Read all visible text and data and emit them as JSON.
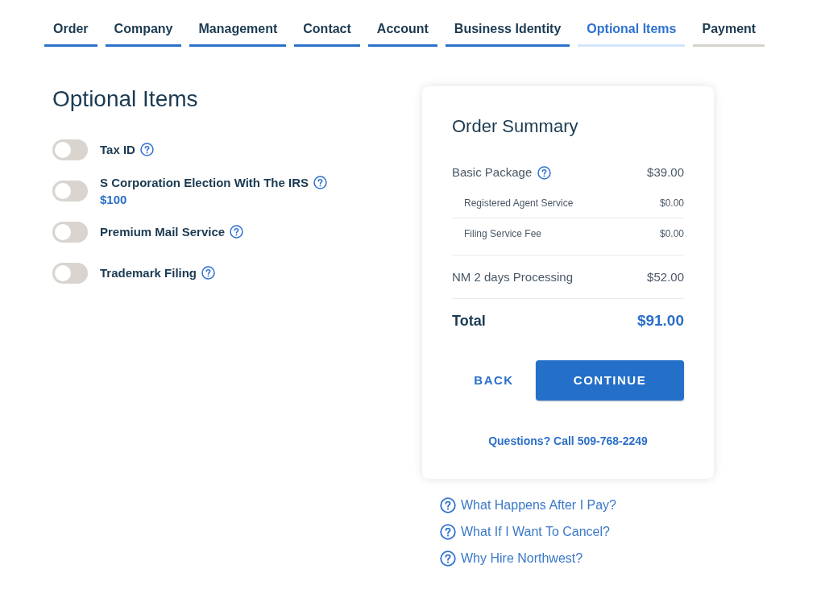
{
  "steps": [
    {
      "label": "Order",
      "selected": false,
      "completed": true
    },
    {
      "label": "Company",
      "selected": false,
      "completed": true
    },
    {
      "label": "Management",
      "selected": false,
      "completed": true
    },
    {
      "label": "Contact",
      "selected": false,
      "completed": true
    },
    {
      "label": "Account",
      "selected": false,
      "completed": true
    },
    {
      "label": "Business Identity",
      "selected": false,
      "completed": true
    },
    {
      "label": "Optional Items",
      "selected": true,
      "completed": false
    },
    {
      "label": "Payment",
      "selected": false,
      "completed": false
    }
  ],
  "heading": "Optional Items",
  "options": [
    {
      "label": "Tax ID",
      "on": false
    },
    {
      "label": "S Corporation Election With The IRS",
      "price": "$100",
      "on": false
    },
    {
      "label": "Premium Mail Service",
      "on": false
    },
    {
      "label": "Trademark Filing",
      "on": false
    }
  ],
  "order_summary": {
    "title": "Order Summary",
    "lines": [
      {
        "kind": "main",
        "label": "Basic Package",
        "help": true,
        "amount": "$39.00"
      },
      {
        "kind": "sub",
        "label": "Registered Agent Service",
        "help": false,
        "amount": "$0.00"
      },
      {
        "kind": "sub",
        "label": "Filing Service Fee",
        "help": false,
        "amount": "$0.00"
      },
      {
        "kind": "main",
        "label": "NM 2 days Processing",
        "help": false,
        "amount": "$52.00"
      }
    ],
    "total": {
      "label": "Total",
      "amount": "$91.00"
    },
    "back_button": "BACK",
    "continue_button": "CONTINUE",
    "phone_link": "Questions? Call 509-768-2249"
  },
  "faq_links": [
    "What Happens After I Pay?",
    "What If I Want To Cancel?",
    "Why Hire Northwest?"
  ]
}
